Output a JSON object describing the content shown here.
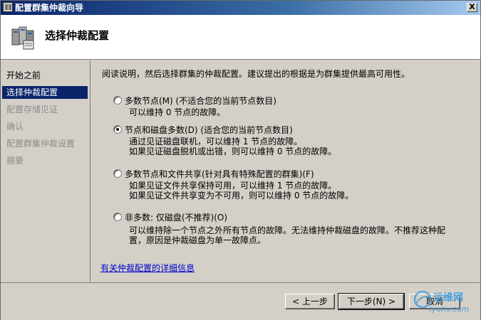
{
  "window": {
    "title": "配置群集仲裁向导",
    "close_label": "X"
  },
  "header": {
    "title": "选择仲裁配置"
  },
  "sidebar": {
    "items": [
      {
        "label": "开始之前",
        "state": "normal"
      },
      {
        "label": "选择仲裁配置",
        "state": "active"
      },
      {
        "label": "配置存储见证",
        "state": "disabled"
      },
      {
        "label": "确认",
        "state": "disabled"
      },
      {
        "label": "配置群集仲裁设置",
        "state": "disabled"
      },
      {
        "label": "摘要",
        "state": "disabled"
      }
    ]
  },
  "main": {
    "instructions": "阅读说明，然后选择群集的仲裁配置。建议提出的根据是为群集提供最高可用性。",
    "options": [
      {
        "label": "多数节点(M)  (不适合您的当前节点数目)",
        "desc": [
          "可以维持 0 节点的故障。"
        ],
        "checked": false
      },
      {
        "label": "节点和磁盘多数(D)  (适合您的当前节点数目)",
        "desc": [
          "通过见证磁盘联机，可以维持 1 节点的故障。",
          "如果见证磁盘脱机或出错，则可以维持 0 节点的故障。"
        ],
        "checked": true
      },
      {
        "label": "多数节点和文件共享(针对具有特殊配置的群集)(F)",
        "desc": [
          "如果见证文件共享保持可用，可以维持 1 节点的故障。",
          "如果见证文件共享变为不可用，则可以维持 0 节点的故障。"
        ],
        "checked": false
      },
      {
        "label": "非多数: 仅磁盘(不推荐)(O)",
        "desc": [
          "可以维持除一个节点之外所有节点的故障。无法维持仲裁磁盘的故障。不推荐这种配",
          "置，原因是仲裁磁盘为单一故障点。"
        ],
        "checked": false
      }
    ],
    "link": "有关仲裁配置的详细信息"
  },
  "footer": {
    "back_label": "< 上一步",
    "next_label": "下一步(N) >",
    "cancel_label": "取消"
  },
  "watermark": {
    "text": "运维网",
    "sub": "iyunv.com"
  }
}
